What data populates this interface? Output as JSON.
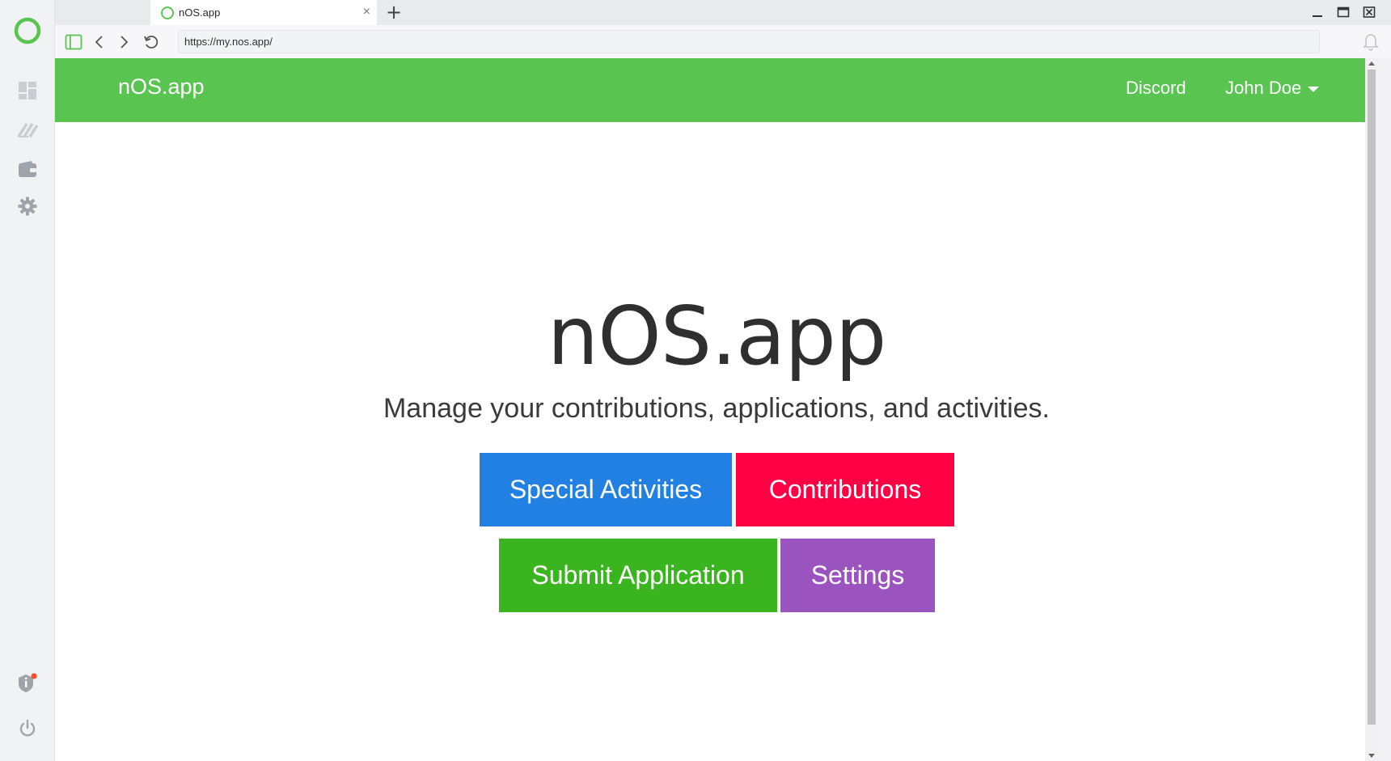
{
  "sidebar": {
    "items": [
      {
        "icon": "nos-logo-icon"
      },
      {
        "icon": "dashboard-icon"
      },
      {
        "icon": "exchange-icon"
      },
      {
        "icon": "wallet-icon"
      },
      {
        "icon": "gear-icon"
      },
      {
        "icon": "info-shield-icon"
      },
      {
        "icon": "power-icon"
      }
    ],
    "notification_color": "#ff4d2e"
  },
  "browser": {
    "tab_title": "nOS.app",
    "tab_close": "×",
    "new_tab": "+",
    "url": "https://my.nos.app/"
  },
  "header": {
    "brand": "nOS.app",
    "links": {
      "discord": "Discord",
      "user": "John Doe"
    }
  },
  "hero": {
    "title": "nOS.app",
    "subtitle": "Manage your contributions, applications, and activities."
  },
  "actions": {
    "special": "Special Activities",
    "contributions": "Contributions",
    "submit": "Submit Application",
    "settings": "Settings"
  },
  "colors": {
    "brand_green": "#5ac451",
    "special": "#2280e3",
    "contributions": "#ff0044",
    "submit": "#3bb51f",
    "settings": "#9b54bf"
  }
}
